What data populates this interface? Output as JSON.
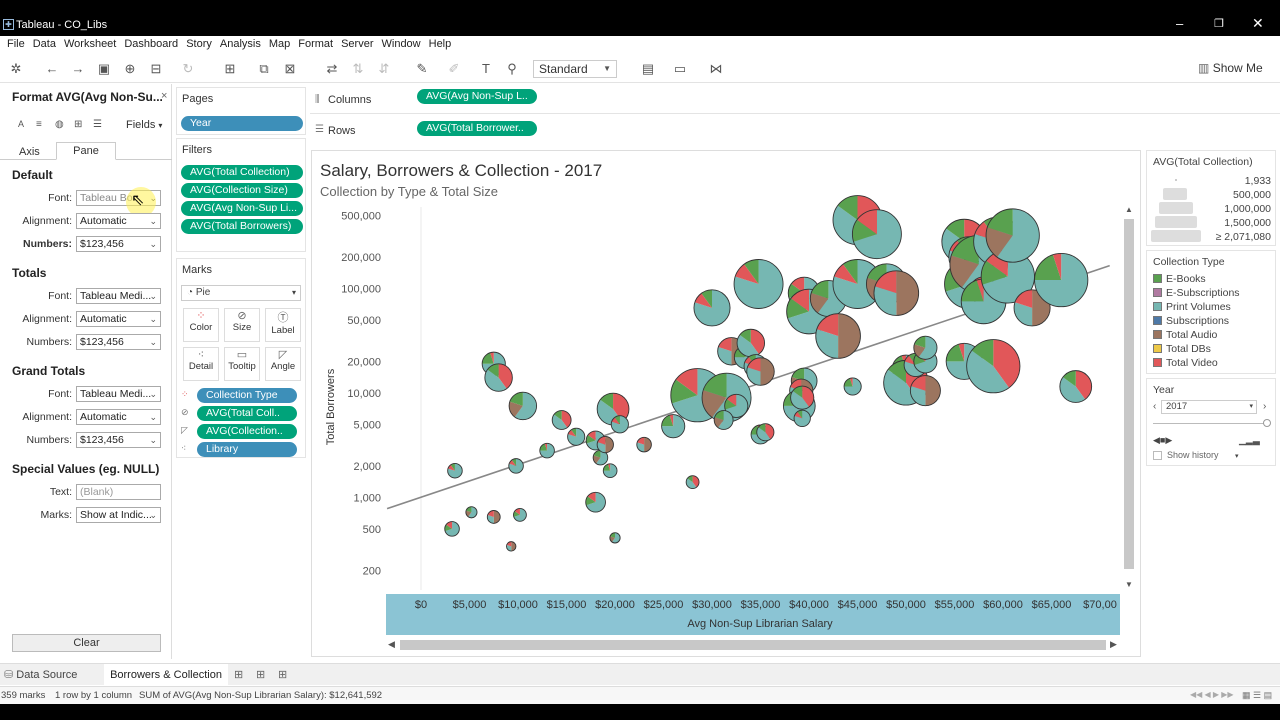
{
  "window": {
    "title": "Tableau - CO_Libs"
  },
  "menu": [
    "File",
    "Data",
    "Worksheet",
    "Dashboard",
    "Story",
    "Analysis",
    "Map",
    "Format",
    "Server",
    "Window",
    "Help"
  ],
  "toolbar": {
    "mark_size_dropdown": "Standard",
    "show_me": "Show Me"
  },
  "format_pane": {
    "title": "Format AVG(Avg Non-Su...",
    "fields_label": "Fields",
    "tabs": [
      "Axis",
      "Pane"
    ],
    "default": {
      "heading": "Default",
      "font_label": "Font:",
      "font_value": "Tableau Bo...",
      "alignment_label": "Alignment:",
      "alignment_value": "Automatic",
      "numbers_label": "Numbers:",
      "numbers_value": "$123,456"
    },
    "totals": {
      "heading": "Totals",
      "font_label": "Font:",
      "font_value": "Tableau Medi...",
      "alignment_label": "Alignment:",
      "alignment_value": "Automatic",
      "numbers_label": "Numbers:",
      "numbers_value": "$123,456"
    },
    "grand_totals": {
      "heading": "Grand Totals",
      "font_label": "Font:",
      "font_value": "Tableau Medi...",
      "alignment_label": "Alignment:",
      "alignment_value": "Automatic",
      "numbers_label": "Numbers:",
      "numbers_value": "$123,456"
    },
    "special": {
      "heading": "Special Values (eg. NULL)",
      "text_label": "Text:",
      "text_placeholder": "(Blank)",
      "marks_label": "Marks:",
      "marks_value": "Show at Indic..."
    },
    "clear_button": "Clear"
  },
  "pages": {
    "title": "Pages",
    "pill": "Year"
  },
  "filters": {
    "title": "Filters",
    "pills": [
      "AVG(Total Collection)",
      "AVG(Collection Size)",
      "AVG(Avg Non-Sup Li...",
      "AVG(Total Borrowers)"
    ]
  },
  "marks": {
    "title": "Marks",
    "type": "Pie",
    "buttons": [
      "Color",
      "Size",
      "Label",
      "Detail",
      "Tooltip",
      "Angle"
    ],
    "pills": [
      "Collection Type",
      "AVG(Total Coll..",
      "AVG(Collection..",
      "Library"
    ]
  },
  "shelves": {
    "columns_label": "Columns",
    "columns_pill": "AVG(Avg Non-Sup L..",
    "rows_label": "Rows",
    "rows_pill": "AVG(Total Borrower.."
  },
  "chart_data": {
    "type": "scatter",
    "title": "Salary, Borrowers & Collection - 2017",
    "subtitle": "Collection by Type & Total Size",
    "xlabel": "Avg Non-Sup Librarian Salary",
    "ylabel": "Total Borrowers",
    "x_ticks": [
      "$0",
      "$5,000",
      "$10,000",
      "$15,000",
      "$20,000",
      "$25,000",
      "$30,000",
      "$35,000",
      "$40,000",
      "$45,000",
      "$50,000",
      "$55,000",
      "$60,000",
      "$65,000",
      "$70,00"
    ],
    "y_ticks": [
      "500,000",
      "200,000",
      "100,000",
      "50,000",
      "20,000",
      "10,000",
      "5,000",
      "2,000",
      "1,000",
      "500",
      "200"
    ],
    "y_scale": "log",
    "xlim": [
      0,
      70000
    ],
    "ylim": [
      130,
      600000
    ],
    "trend_line": {
      "x": [
        -3500,
        71000
      ],
      "y": [
        780,
        165000
      ]
    },
    "series_colors": {
      "E-Books": "#59a14f",
      "E-Subscriptions": "#b07aa1",
      "Print Volumes": "#76b7b2",
      "Subscriptions": "#4e79a7",
      "Total Audio": "#9c755f",
      "Total DBs": "#edc948",
      "Total Video": "#e15759"
    },
    "points": [
      {
        "x": 3500,
        "y": 1800,
        "size": 1
      },
      {
        "x": 3200,
        "y": 500,
        "size": 1
      },
      {
        "x": 5200,
        "y": 720,
        "size": 0.6
      },
      {
        "x": 7500,
        "y": 650,
        "size": 0.8
      },
      {
        "x": 7500,
        "y": 19000,
        "size": 2
      },
      {
        "x": 8000,
        "y": 14000,
        "size": 2.5
      },
      {
        "x": 9800,
        "y": 2000,
        "size": 1
      },
      {
        "x": 10200,
        "y": 680,
        "size": 0.8
      },
      {
        "x": 10500,
        "y": 7500,
        "size": 2.5
      },
      {
        "x": 9300,
        "y": 340,
        "size": 0.4
      },
      {
        "x": 13000,
        "y": 2800,
        "size": 1
      },
      {
        "x": 14500,
        "y": 5500,
        "size": 1.5
      },
      {
        "x": 16000,
        "y": 3800,
        "size": 1.3
      },
      {
        "x": 18000,
        "y": 3500,
        "size": 1.5
      },
      {
        "x": 18500,
        "y": 2400,
        "size": 1
      },
      {
        "x": 19000,
        "y": 3200,
        "size": 1.2
      },
      {
        "x": 19500,
        "y": 1800,
        "size": 0.9
      },
      {
        "x": 19800,
        "y": 7000,
        "size": 3
      },
      {
        "x": 20500,
        "y": 5000,
        "size": 1.3
      },
      {
        "x": 18000,
        "y": 900,
        "size": 1.6
      },
      {
        "x": 20000,
        "y": 410,
        "size": 0.5
      },
      {
        "x": 23000,
        "y": 3200,
        "size": 1
      },
      {
        "x": 26000,
        "y": 4800,
        "size": 2
      },
      {
        "x": 28000,
        "y": 1400,
        "size": 0.8
      },
      {
        "x": 30000,
        "y": 65000,
        "size": 3.5
      },
      {
        "x": 28500,
        "y": 9500,
        "size": 5.5
      },
      {
        "x": 31500,
        "y": 9000,
        "size": 5
      },
      {
        "x": 32000,
        "y": 25000,
        "size": 2.5
      },
      {
        "x": 33500,
        "y": 22000,
        "size": 2
      },
      {
        "x": 34000,
        "y": 30000,
        "size": 2.5
      },
      {
        "x": 34500,
        "y": 18000,
        "size": 2
      },
      {
        "x": 32500,
        "y": 7500,
        "size": 2
      },
      {
        "x": 31200,
        "y": 5500,
        "size": 1.5
      },
      {
        "x": 35000,
        "y": 16000,
        "size": 2.5
      },
      {
        "x": 35000,
        "y": 4000,
        "size": 1.5
      },
      {
        "x": 35500,
        "y": 4200,
        "size": 1.3
      },
      {
        "x": 34800,
        "y": 110000,
        "size": 5
      },
      {
        "x": 39500,
        "y": 90000,
        "size": 3
      },
      {
        "x": 39500,
        "y": 13000,
        "size": 2.3
      },
      {
        "x": 39200,
        "y": 10500,
        "size": 2
      },
      {
        "x": 39000,
        "y": 7500,
        "size": 3
      },
      {
        "x": 39300,
        "y": 9000,
        "size": 2
      },
      {
        "x": 39300,
        "y": 5700,
        "size": 1.2
      },
      {
        "x": 40000,
        "y": 60000,
        "size": 4.5
      },
      {
        "x": 42000,
        "y": 80000,
        "size": 3.5
      },
      {
        "x": 43000,
        "y": 35000,
        "size": 4.5
      },
      {
        "x": 44500,
        "y": 11500,
        "size": 1.3
      },
      {
        "x": 45000,
        "y": 450000,
        "size": 5
      },
      {
        "x": 45000,
        "y": 110000,
        "size": 5
      },
      {
        "x": 47000,
        "y": 330000,
        "size": 5
      },
      {
        "x": 48000,
        "y": 110000,
        "size": 4
      },
      {
        "x": 49000,
        "y": 90000,
        "size": 4.5
      },
      {
        "x": 50000,
        "y": 17000,
        "size": 2.5
      },
      {
        "x": 50000,
        "y": 12500,
        "size": 4.5
      },
      {
        "x": 51000,
        "y": 18500,
        "size": 2
      },
      {
        "x": 52000,
        "y": 20000,
        "size": 2
      },
      {
        "x": 52000,
        "y": 27000,
        "size": 2
      },
      {
        "x": 52000,
        "y": 10500,
        "size": 2.8
      },
      {
        "x": 56000,
        "y": 20000,
        "size": 3.5
      },
      {
        "x": 56000,
        "y": 280000,
        "size": 4.5
      },
      {
        "x": 56500,
        "y": 200000,
        "size": 4
      },
      {
        "x": 56500,
        "y": 110000,
        "size": 5
      },
      {
        "x": 57500,
        "y": 170000,
        "size": 6
      },
      {
        "x": 58000,
        "y": 95000,
        "size": 2.5
      },
      {
        "x": 58000,
        "y": 75000,
        "size": 4.5
      },
      {
        "x": 59000,
        "y": 18000,
        "size": 5.5
      },
      {
        "x": 59500,
        "y": 280000,
        "size": 5
      },
      {
        "x": 60500,
        "y": 130000,
        "size": 5.5
      },
      {
        "x": 61000,
        "y": 320000,
        "size": 5.5
      },
      {
        "x": 63000,
        "y": 65000,
        "size": 3.5
      },
      {
        "x": 66000,
        "y": 120000,
        "size": 5.5
      },
      {
        "x": 67500,
        "y": 11500,
        "size": 3
      }
    ]
  },
  "legend_size": {
    "title": "AVG(Total Collection)",
    "items": [
      "1,933",
      "500,000",
      "1,000,000",
      "1,500,000",
      "≥ 2,071,080"
    ]
  },
  "legend_color": {
    "title": "Collection Type",
    "items": [
      {
        "label": "E-Books",
        "color": "#59a14f"
      },
      {
        "label": "E-Subscriptions",
        "color": "#b07aa1"
      },
      {
        "label": "Print Volumes",
        "color": "#76b7b2"
      },
      {
        "label": "Subscriptions",
        "color": "#4e79a7"
      },
      {
        "label": "Total Audio",
        "color": "#9c755f"
      },
      {
        "label": "Total DBs",
        "color": "#edc948"
      },
      {
        "label": "Total Video",
        "color": "#e15759"
      }
    ]
  },
  "year_filter": {
    "title": "Year",
    "value": "2017",
    "show_history": "Show history"
  },
  "sheet_tabs": {
    "data_source": "Data Source",
    "active": "Borrowers & Collection"
  },
  "statusbar": {
    "marks": "359 marks",
    "rows": "1 row by 1 column",
    "sum": "SUM of AVG(Avg Non-Sup Librarian Salary): $12,641,592"
  }
}
